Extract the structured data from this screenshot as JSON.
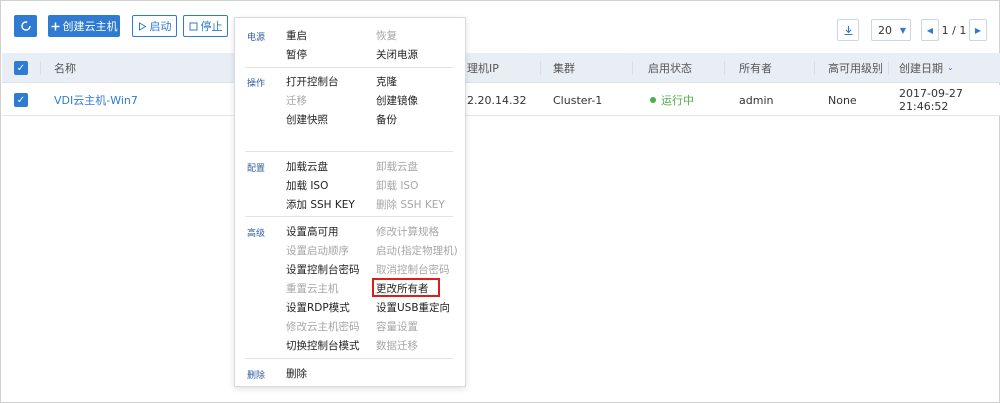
{
  "toolbar": {
    "refresh_icon": "refresh-icon",
    "create_label": "创建云主机",
    "start_label": "启动",
    "stop_label": "停止",
    "page_size": "20",
    "page_indicator": "1 / 1"
  },
  "table": {
    "headers": {
      "name": "名称",
      "ip": "理机IP",
      "cluster": "集群",
      "status": "启用状态",
      "owner": "所有者",
      "ha": "高可用级别",
      "created": "创建日期"
    },
    "rows": [
      {
        "name": "VDI云主机-Win7",
        "ip": "2.20.14.32",
        "cluster": "Cluster-1",
        "status": "运行中",
        "owner": "admin",
        "ha": "None",
        "created": "2017-09-27 21:46:52"
      }
    ]
  },
  "menu": {
    "groups": {
      "power": "电源",
      "operate": "操作",
      "config": "配置",
      "advanced": "高级",
      "delete": "删除"
    },
    "items": {
      "restart": "重启",
      "resume": "恢复",
      "pause": "暂停",
      "poweroff": "关闭电源",
      "open_console": "打开控制台",
      "clone": "克隆",
      "migrate": "迁移",
      "create_image": "创建镜像",
      "create_snapshot": "创建快照",
      "backup": "备份",
      "attach_disk": "加载云盘",
      "detach_disk": "卸载云盘",
      "attach_iso": "加载 ISO",
      "detach_iso": "卸载 ISO",
      "add_ssh": "添加 SSH KEY",
      "del_ssh": "删除 SSH KEY",
      "set_ha": "设置高可用",
      "change_spec": "修改计算规格",
      "boot_order": "设置启动顺序",
      "start_on_host": "启动(指定物理机)",
      "set_console_pwd": "设置控制台密码",
      "cancel_console_pwd": "取消控制台密码",
      "reset_vm": "重置云主机",
      "change_owner": "更改所有者",
      "rdp_mode": "设置RDP模式",
      "usb_redirect": "设置USB重定向",
      "change_vm_pwd": "修改云主机密码",
      "capacity": "容量设置",
      "console_mode": "切换控制台模式",
      "data_migrate": "数据迁移",
      "delete": "删除"
    }
  },
  "colors": {
    "accent": "#2f7bd1",
    "running": "#4cae4c",
    "highlight": "#e01b1b",
    "header_bg": "#e9eef5"
  }
}
